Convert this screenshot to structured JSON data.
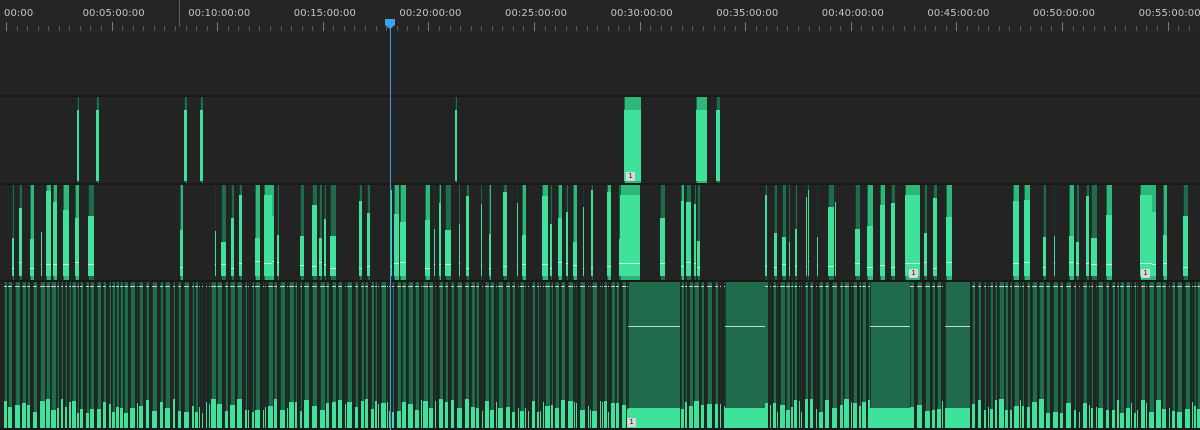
{
  "timeline": {
    "ruler": {
      "labels": [
        "00:00",
        "00:05:00:00",
        "00:10:00:00",
        "00:15:00:00",
        "00:20:00:00",
        "00:25:00:00",
        "00:30:00:00",
        "00:35:00:00",
        "00:40:00:00",
        "00:45:00:00",
        "00:50:00:00",
        "00:55:00:00"
      ],
      "interval_minutes": 5
    },
    "playhead": {
      "time": "00:18:10:00",
      "minutes": 18.17,
      "color": "#3aa3f0"
    },
    "tracks": [
      {
        "name": "empty-track"
      },
      {
        "name": "audio-track-1",
        "badges": [
          "1"
        ]
      },
      {
        "name": "audio-track-2",
        "badges": [
          "1",
          "1"
        ]
      },
      {
        "name": "audio-track-3",
        "badges": [
          "1"
        ]
      }
    ],
    "colors": {
      "clip_fill": "#1f6b4b",
      "clip_bright": "#2bb879",
      "waveform": "#3fe29a",
      "track_bg": "#232323",
      "ruler_bg": "#252525"
    }
  }
}
